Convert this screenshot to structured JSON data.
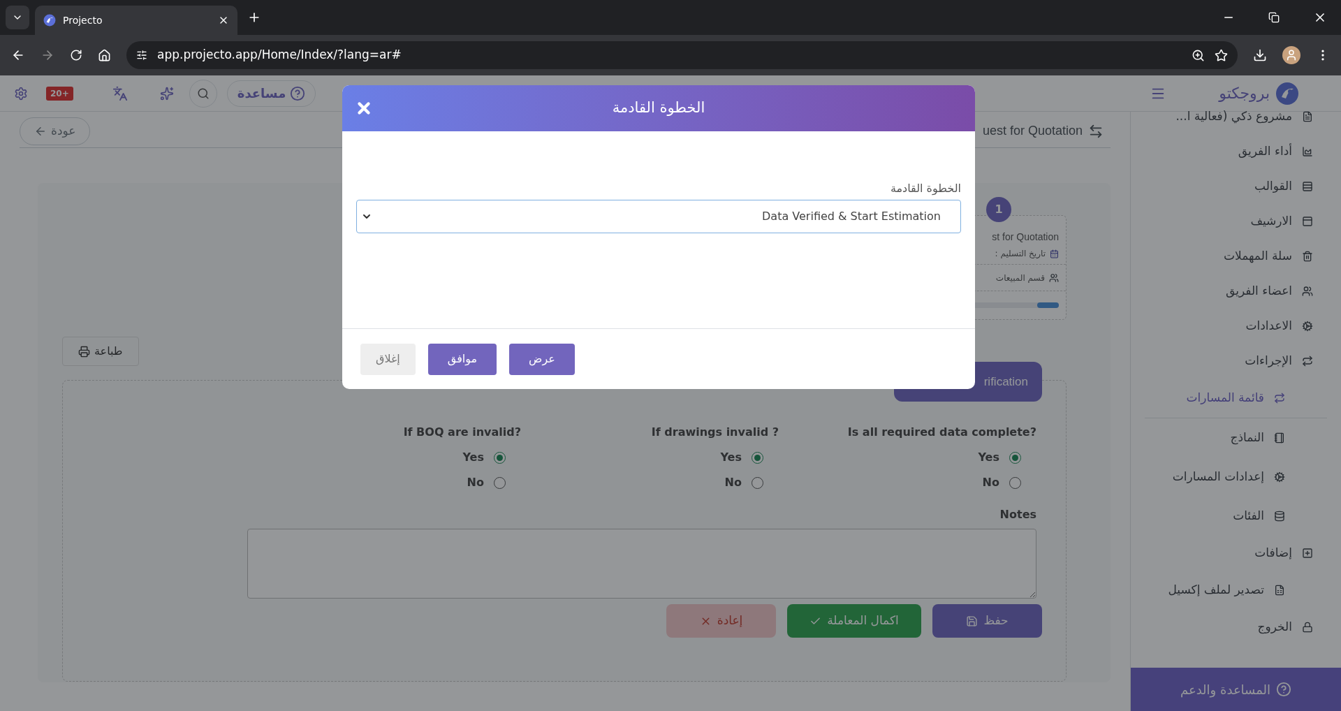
{
  "browser": {
    "tab": {
      "title": "Projecto"
    },
    "address": "app.projecto.app/Home/Index/?lang=ar#"
  },
  "header": {
    "notification_badge": "20+",
    "help": "مساعدة",
    "brand": "بروجكتو"
  },
  "page": {
    "back": "عودة",
    "title": "uest for Quotation",
    "stage": {
      "number": "1",
      "name": "st for Quotation",
      "date_label": "تاريخ التسليم :",
      "department": "قسم المبيعات",
      "level": 0.18
    },
    "print": "طباعة",
    "section_tab": "rification",
    "questions": [
      {
        "label": "Is all required data complete?",
        "options": [
          {
            "label": "Yes",
            "selected": true
          },
          {
            "label": "No",
            "selected": false
          }
        ]
      },
      {
        "label": "If drawings invalid ?",
        "options": [
          {
            "label": "Yes",
            "selected": true
          },
          {
            "label": "No",
            "selected": false
          }
        ]
      },
      {
        "label": "If BOQ are invalid?",
        "options": [
          {
            "label": "Yes",
            "selected": true
          },
          {
            "label": "No",
            "selected": false
          }
        ]
      }
    ],
    "notes": {
      "label": "Notes"
    },
    "actions": [
      {
        "label": "حفظ",
        "kind": "save"
      },
      {
        "label": "اكمال المعاملة",
        "kind": "complete"
      },
      {
        "label": "إعادة",
        "kind": "reset"
      }
    ]
  },
  "sidebar": {
    "items": [
      {
        "label": "مشروع ذكي (فعالية ا...",
        "selected": false
      },
      {
        "label": "أداء الفريق",
        "selected": false
      },
      {
        "label": "القوالب",
        "selected": false
      },
      {
        "label": "الارشيف",
        "selected": false
      },
      {
        "label": "سلة المهملات",
        "selected": false
      },
      {
        "label": "اعضاء الفريق",
        "selected": false
      },
      {
        "label": "الاعدادات",
        "selected": false
      },
      {
        "label": "الإجراءات",
        "selected": false,
        "children": [
          {
            "label": "قائمة المسارات",
            "selected": true
          },
          {
            "label": "النماذج",
            "selected": false
          },
          {
            "label": "إعدادات المسارات",
            "selected": false
          },
          {
            "label": "الفئات",
            "selected": false
          }
        ]
      },
      {
        "label": "إضافات",
        "selected": false,
        "children": [
          {
            "label": "تصدير لملف إكسيل",
            "selected": false
          }
        ]
      },
      {
        "label": "الخروج",
        "selected": false
      }
    ],
    "footer": "المساعدة والدعم"
  },
  "modal": {
    "title": "الخطوة القادمة",
    "field": {
      "label": "الخطوة القادمة",
      "value": "Data Verified & Start Estimation"
    },
    "buttons": [
      {
        "label": "عرض",
        "kind": "primary"
      },
      {
        "label": "موافق",
        "kind": "primary"
      },
      {
        "label": "إغلاق",
        "kind": "secondary"
      }
    ]
  }
}
